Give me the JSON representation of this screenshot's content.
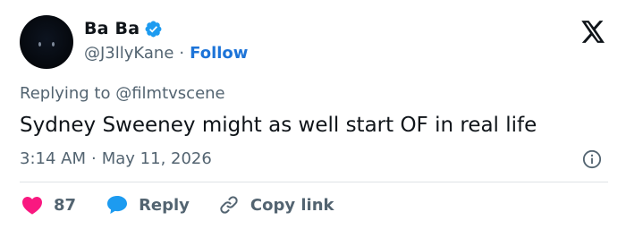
{
  "author": {
    "display_name": "Ba Ba",
    "handle": "@J3llyKane",
    "separator": "·",
    "follow_label": "Follow"
  },
  "reply_context": {
    "prefix": "Replying to",
    "mention": "@filmtvscene"
  },
  "tweet": {
    "text": "Sydney Sweeney might as well start OF in real life",
    "time": "3:14 AM",
    "separator": "·",
    "date": "May 11, 2026"
  },
  "actions": {
    "like_count": "87",
    "reply_label": "Reply",
    "copy_label": "Copy link"
  },
  "colors": {
    "like": "#f91880",
    "reply": "#1d9bf0",
    "link_blue": "#1d74d8",
    "muted": "#536471",
    "verified": "#1d9bf0"
  },
  "icons": [
    "x-logo-icon",
    "verified-badge-icon",
    "info-icon",
    "heart-icon",
    "reply-bubble-icon",
    "link-icon"
  ]
}
